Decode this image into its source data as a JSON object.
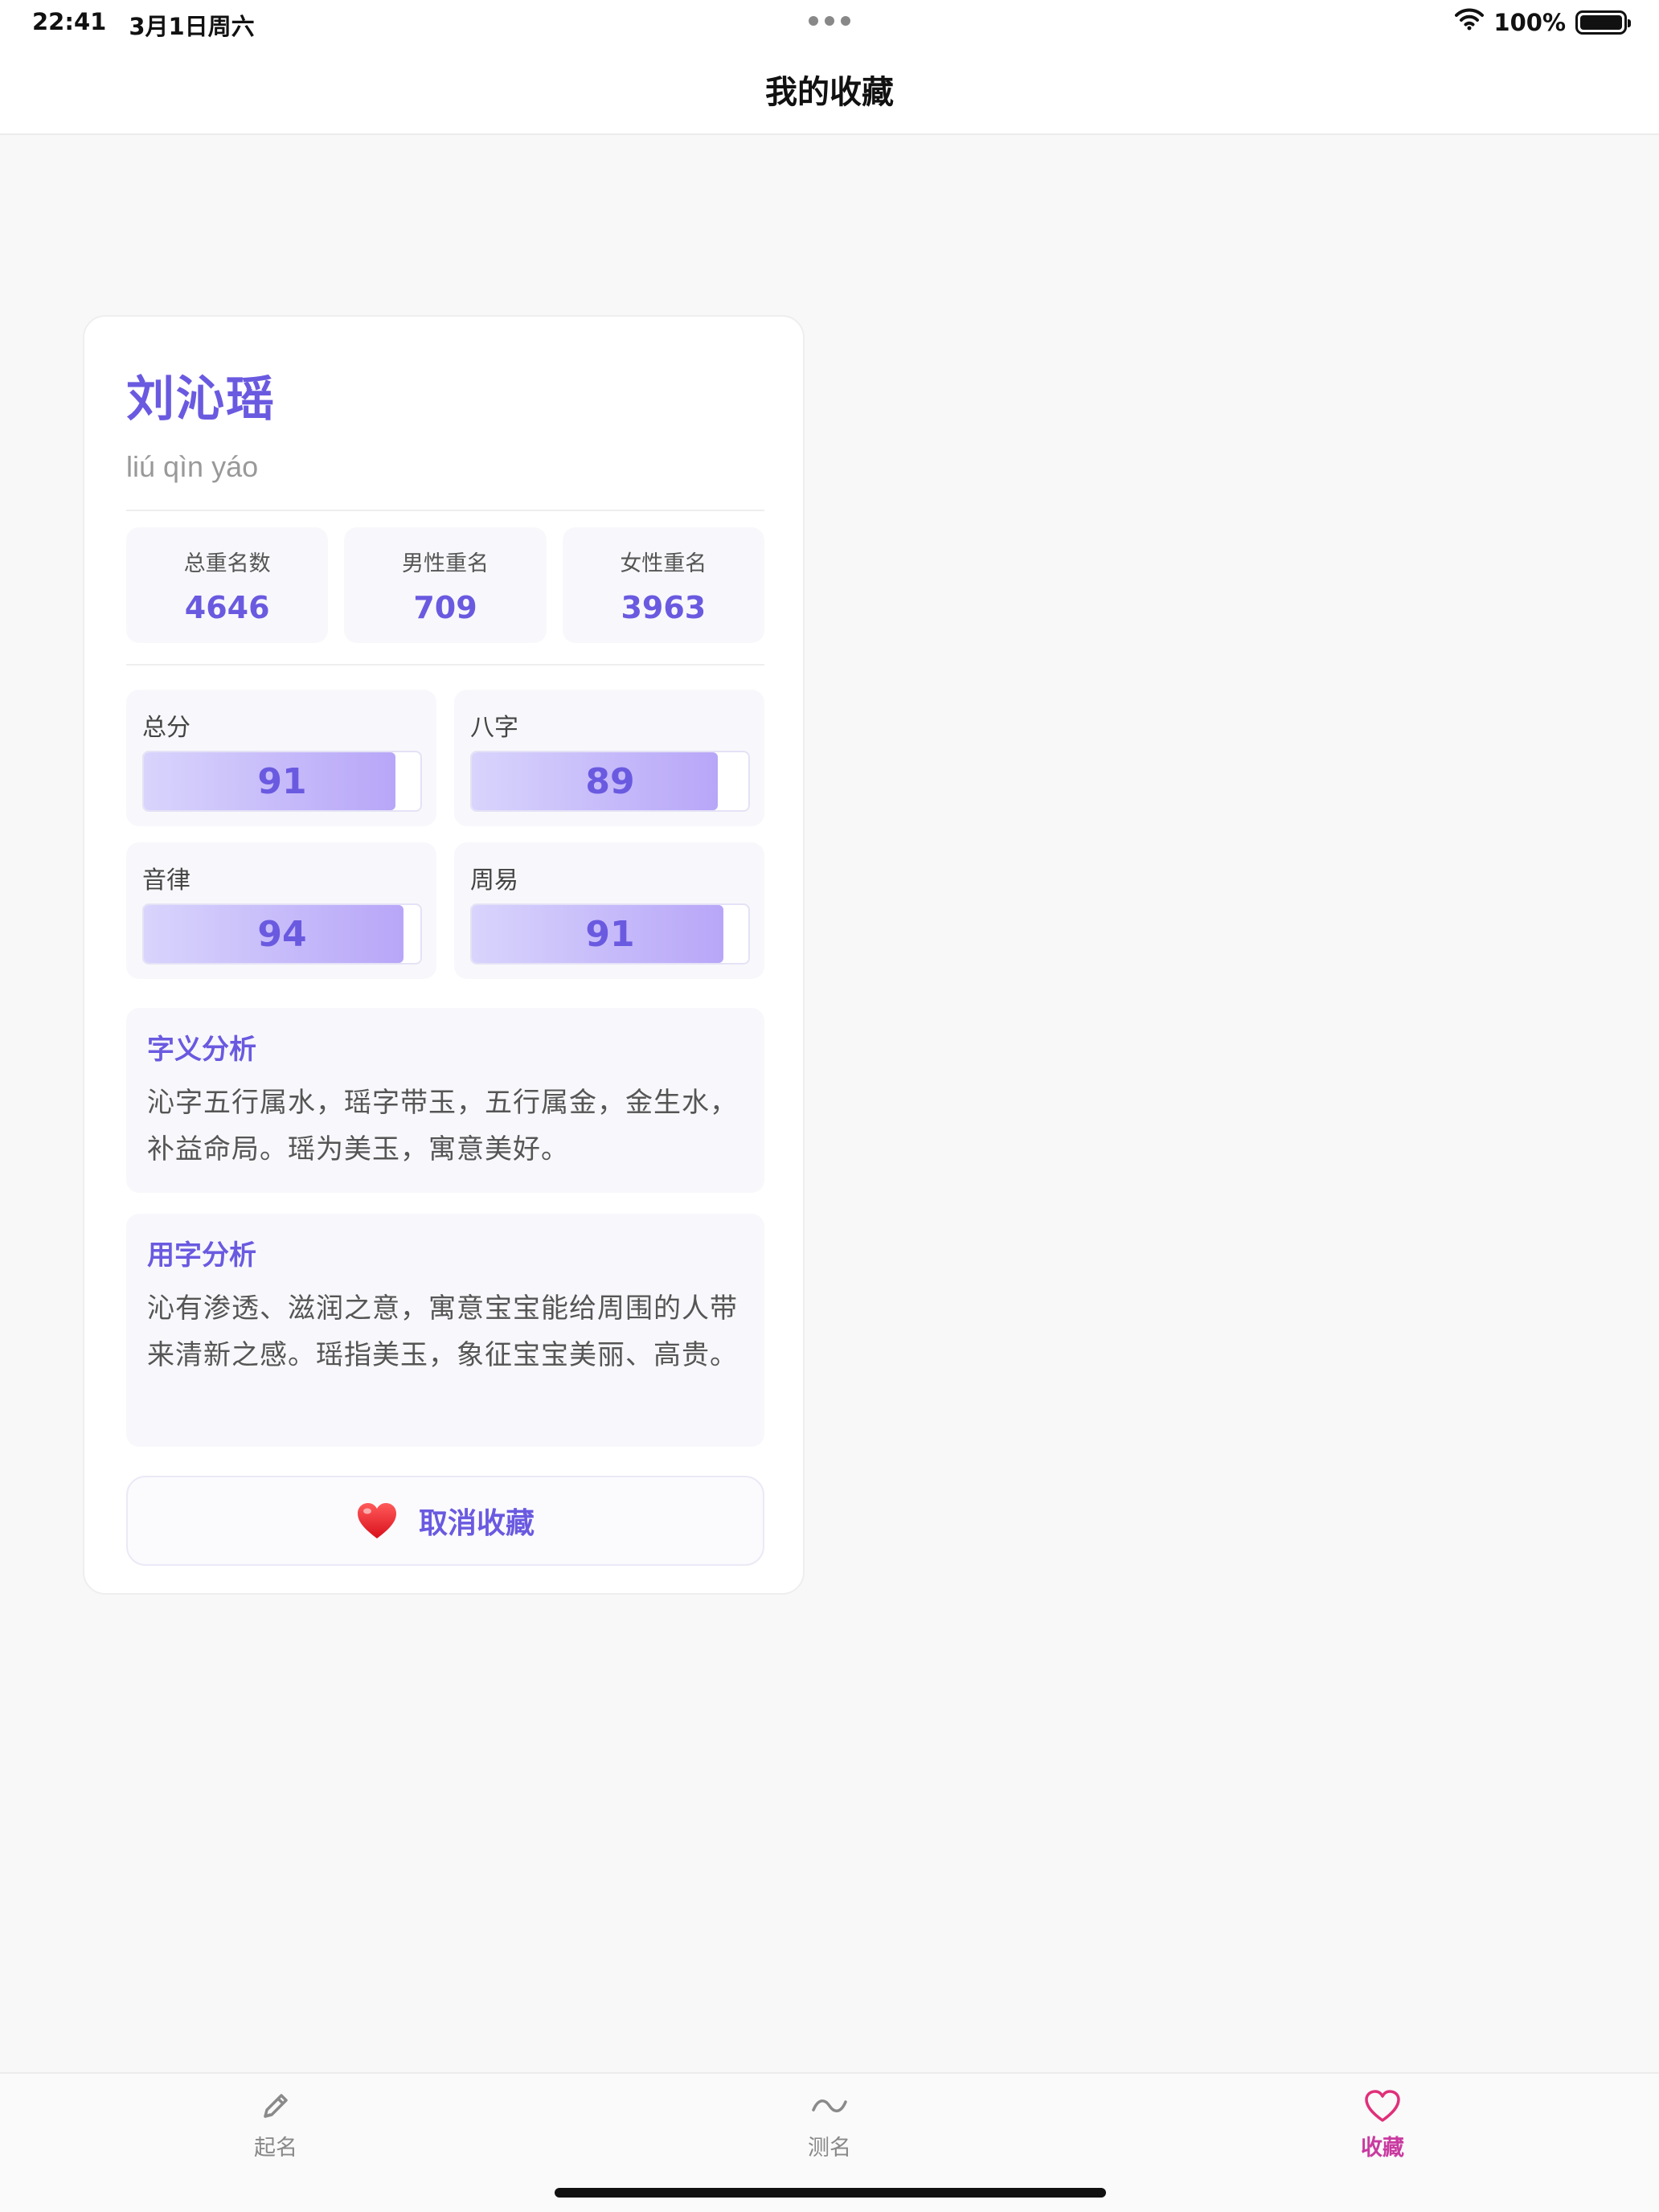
{
  "status_bar": {
    "time": "22:41",
    "date": "3月1日周六",
    "battery": "100%",
    "icons": [
      "wifi-icon",
      "battery-icon"
    ]
  },
  "header": {
    "title": "我的收藏"
  },
  "card": {
    "name": "刘沁瑶",
    "pinyin": "liú qìn yáo",
    "stats": [
      {
        "label": "总重名数",
        "value": "4646"
      },
      {
        "label": "男性重名",
        "value": "709"
      },
      {
        "label": "女性重名",
        "value": "3963"
      }
    ],
    "scores": [
      {
        "label": "总分",
        "value": "91",
        "fill_percent": 91
      },
      {
        "label": "八字",
        "value": "89",
        "fill_percent": 89
      },
      {
        "label": "音律",
        "value": "94",
        "fill_percent": 94
      },
      {
        "label": "周易",
        "value": "91",
        "fill_percent": 91
      }
    ],
    "meaning": {
      "title": "字义分析",
      "text": "沁字五行属水，瑶字带玉，五行属金，金生水，补益命局。瑶为美玉，寓意美好。"
    },
    "usage": {
      "title": "用字分析",
      "text": "沁有渗透、滋润之意，寓意宝宝能给周围的人带来清新之感。瑶指美玉，象征宝宝美丽、高贵。"
    },
    "unfavorite_label": "取消收藏",
    "unfavorite_icon": "heart-icon"
  },
  "tab_bar": {
    "tabs": [
      {
        "label": "起名",
        "icon": "pencil-icon"
      },
      {
        "label": "测名",
        "icon": "wave-icon"
      },
      {
        "label": "收藏",
        "icon": "heart-outline-icon"
      }
    ],
    "active": "收藏"
  },
  "colors": {
    "accent": "#6a5ae0",
    "active_tab": "#c93aa0",
    "background": "#f8f8f8"
  }
}
